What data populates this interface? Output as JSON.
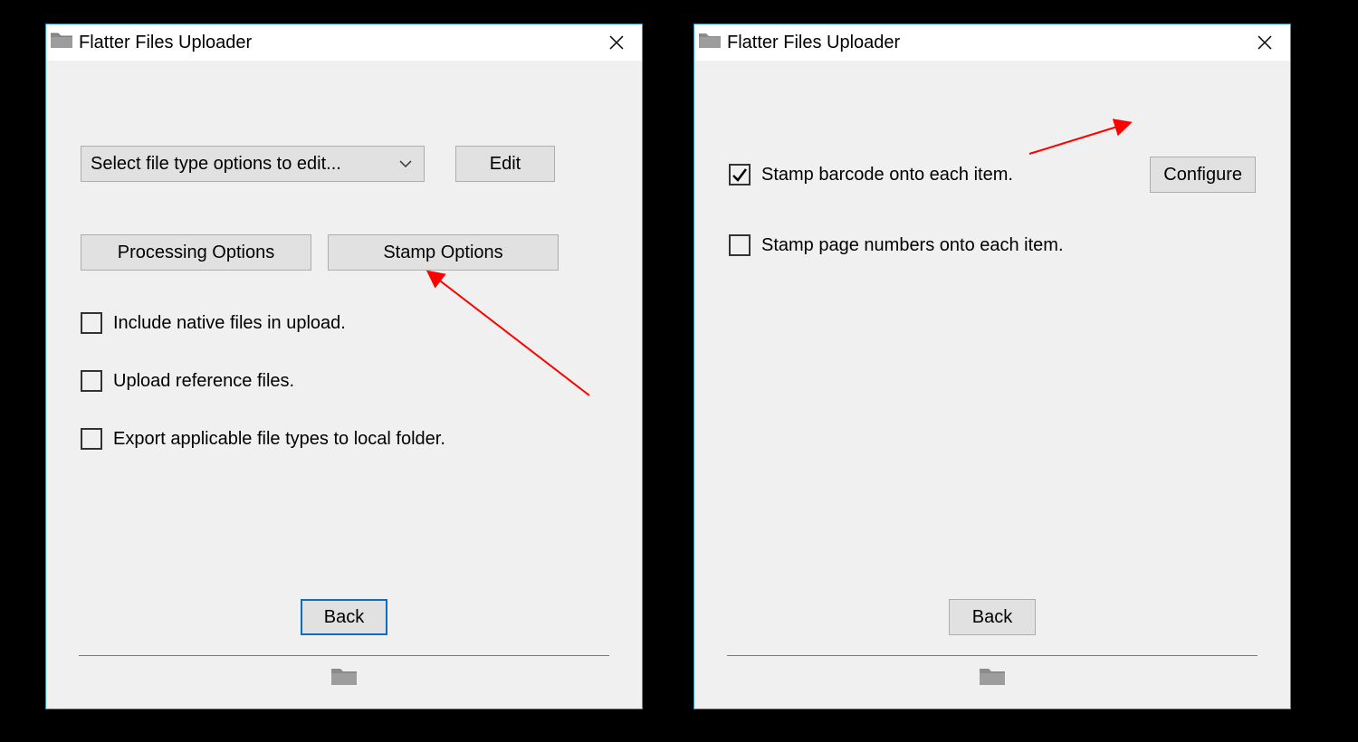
{
  "app": {
    "title": "Flatter Files Uploader"
  },
  "left": {
    "dropdown_label": "Select file type options to edit...",
    "edit_label": "Edit",
    "processing_options_label": "Processing Options",
    "stamp_options_label": "Stamp Options",
    "checks": [
      {
        "label": "Include native files in upload.",
        "checked": false
      },
      {
        "label": "Upload reference files.",
        "checked": false
      },
      {
        "label": "Export applicable file types to local folder.",
        "checked": false
      }
    ],
    "back_label": "Back"
  },
  "right": {
    "configure_label": "Configure",
    "checks": [
      {
        "label": "Stamp barcode onto each item.",
        "checked": true
      },
      {
        "label": "Stamp page numbers onto each item.",
        "checked": false
      }
    ],
    "back_label": "Back"
  },
  "colors": {
    "window_border": "#2f8fd1",
    "button_bg": "#e1e1e1",
    "button_border": "#adadad",
    "focus_border": "#0a6fc2",
    "annotation_red": "#ff0000"
  }
}
